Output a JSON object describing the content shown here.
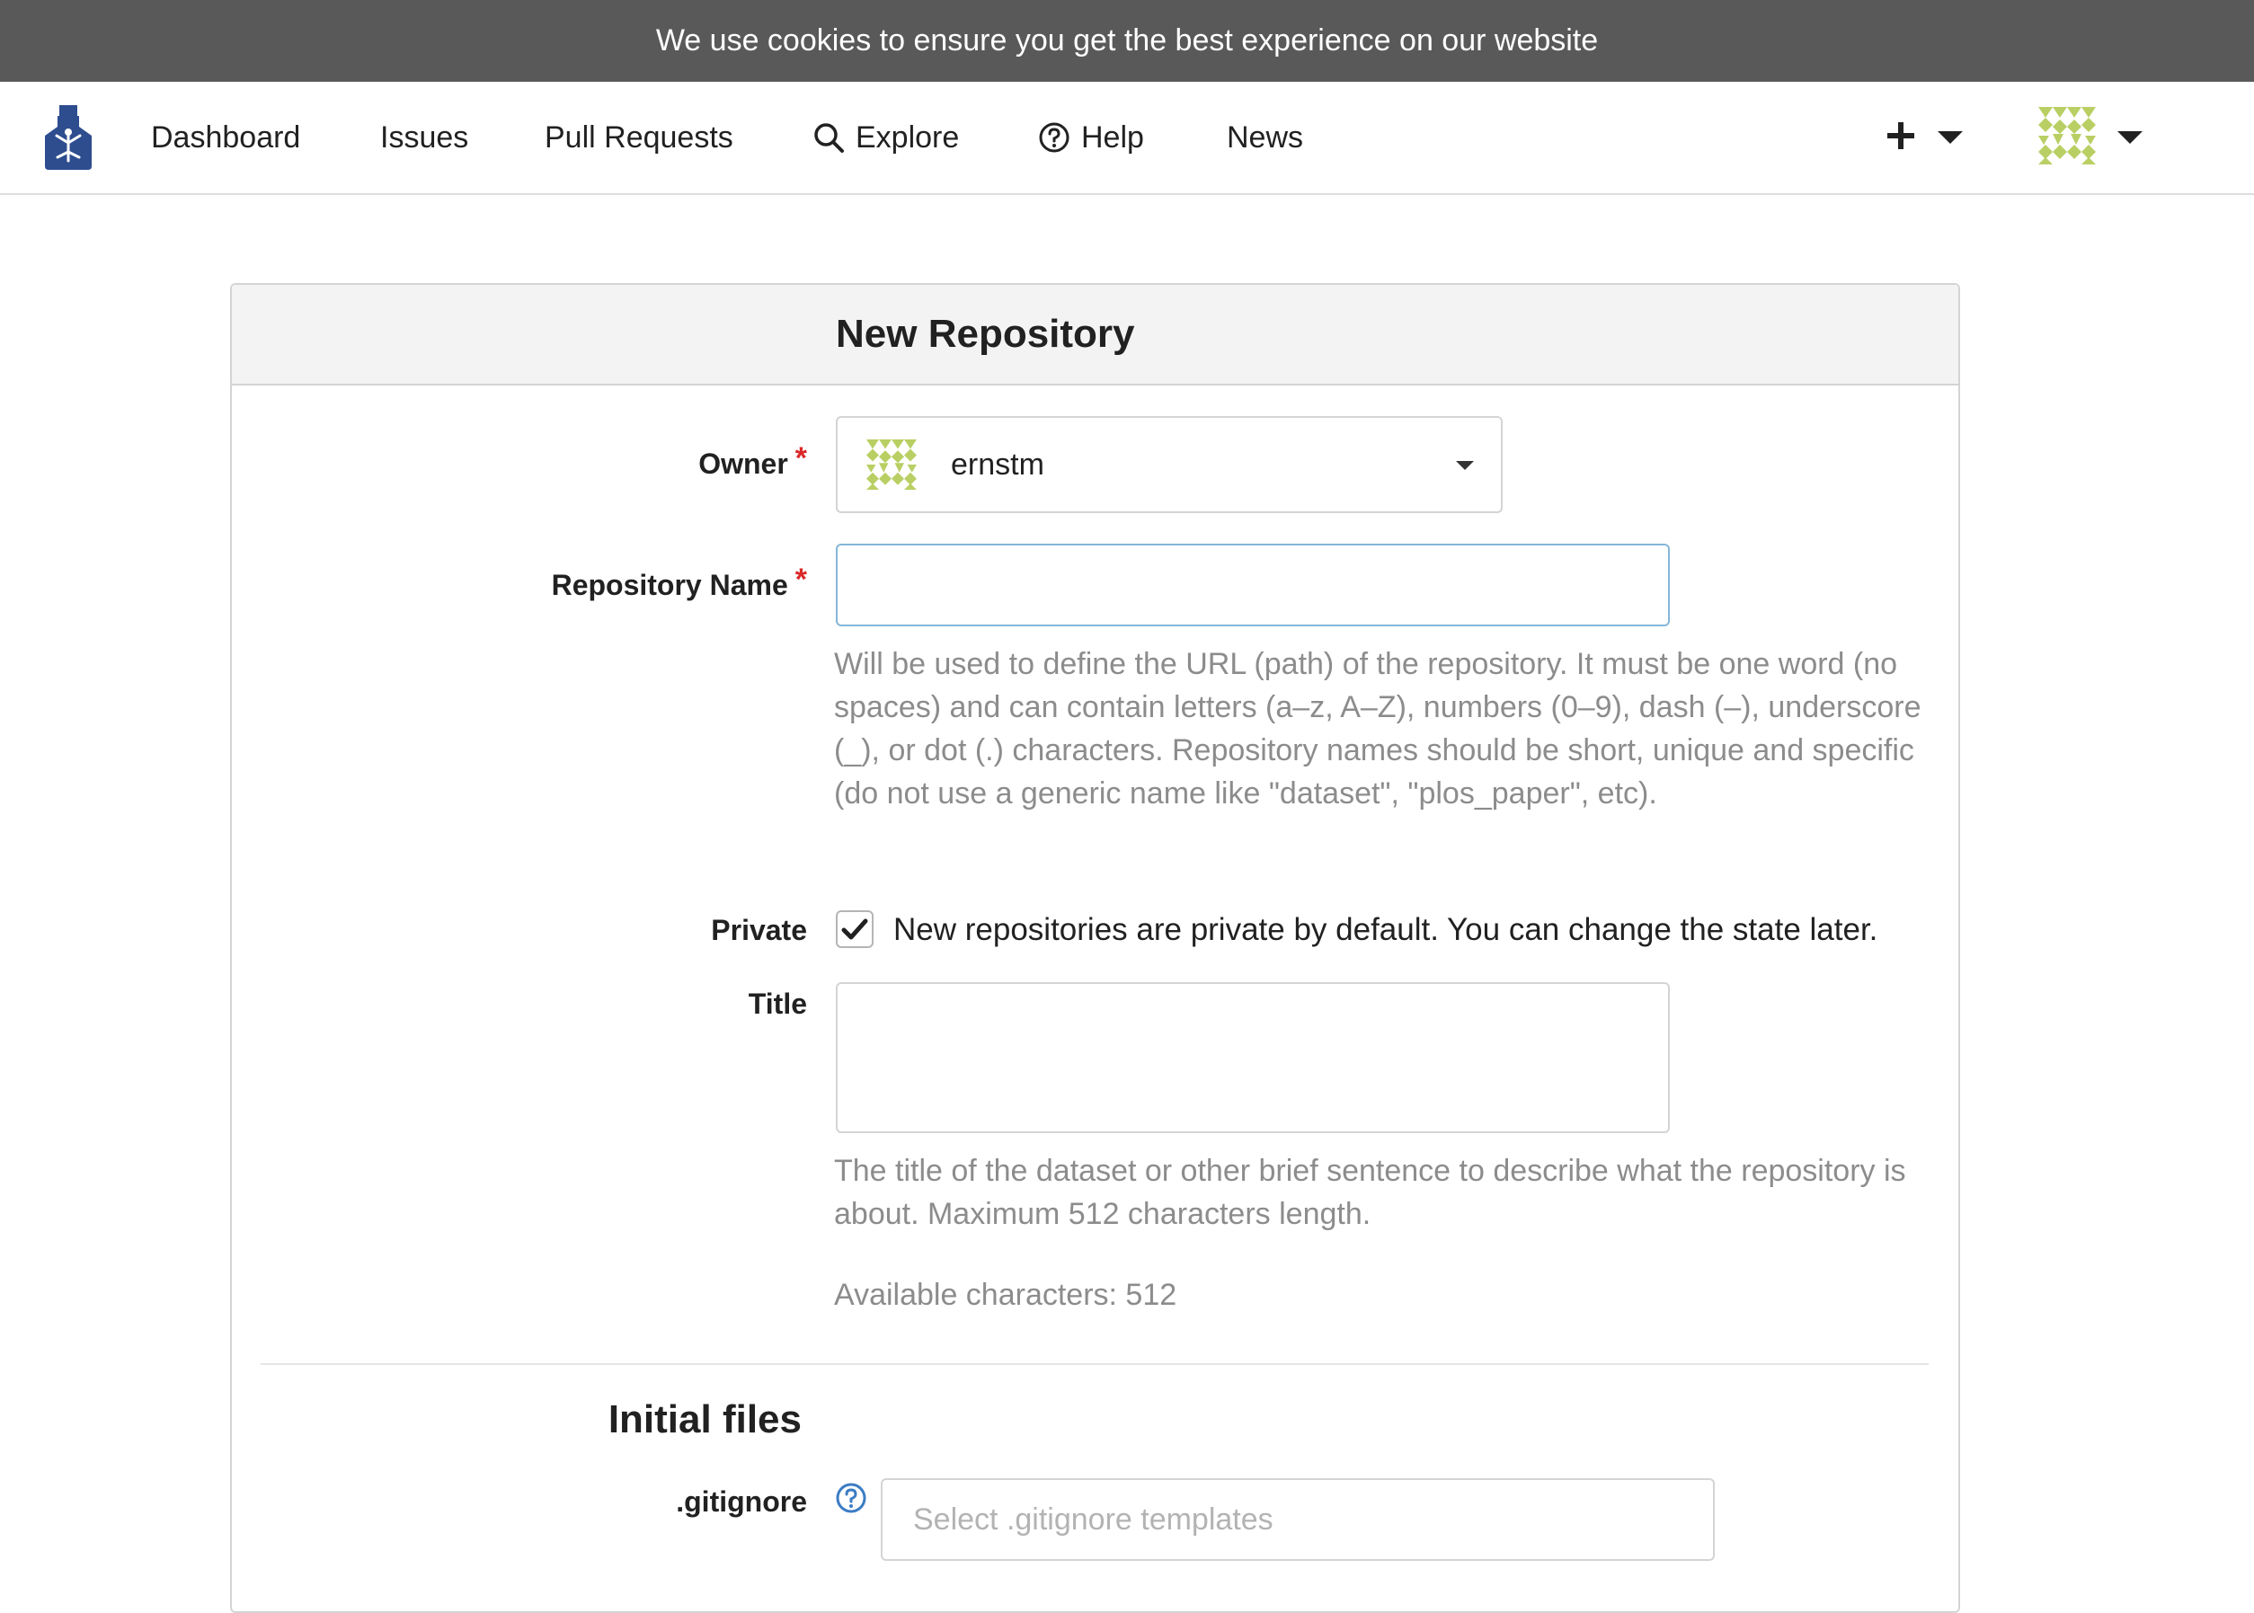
{
  "cookie_banner": {
    "text": "We use cookies to ensure you get the best experience on our website"
  },
  "nav": {
    "dashboard": "Dashboard",
    "issues": "Issues",
    "pull_requests": "Pull Requests",
    "explore": "Explore",
    "help": "Help",
    "news": "News",
    "icons": {
      "logo": "gin-logo-icon",
      "explore": "search-icon",
      "help": "question-circle-icon",
      "create": "plus-icon",
      "user": "identicon-avatar"
    }
  },
  "form": {
    "title": "New Repository",
    "owner_label": "Owner",
    "owner_value": "ernstm",
    "required_mark": "*",
    "repo_name_label": "Repository Name",
    "repo_name_value": "",
    "repo_name_help": "Will be used to define the URL (path) of the repository. It must be one word (no spaces) and can contain letters (a–z, A–Z), numbers (0–9), dash (–), underscore (_), or dot (.) characters. Repository names should be short, unique and specific (do not use a generic name like \"dataset\", \"plos_paper\", etc).",
    "private_label": "Private",
    "private_checked": true,
    "private_text": "New repositories are private by default. You can change the state later.",
    "title_label": "Title",
    "title_value": "",
    "title_help": "The title of the dataset or other brief sentence to describe what the repository is about. Maximum 512 characters length.",
    "available_chars": "Available characters: 512",
    "initial_files_heading": "Initial files",
    "gitignore_label": ".gitignore",
    "gitignore_placeholder": "Select .gitignore templates"
  },
  "colors": {
    "banner_bg": "#595959",
    "logo_blue": "#2e4d8f",
    "identicon_green": "#b9cf64",
    "required_red": "#db2828",
    "focus_border": "#85b7d9",
    "help_icon_blue": "#3b7cc4"
  }
}
